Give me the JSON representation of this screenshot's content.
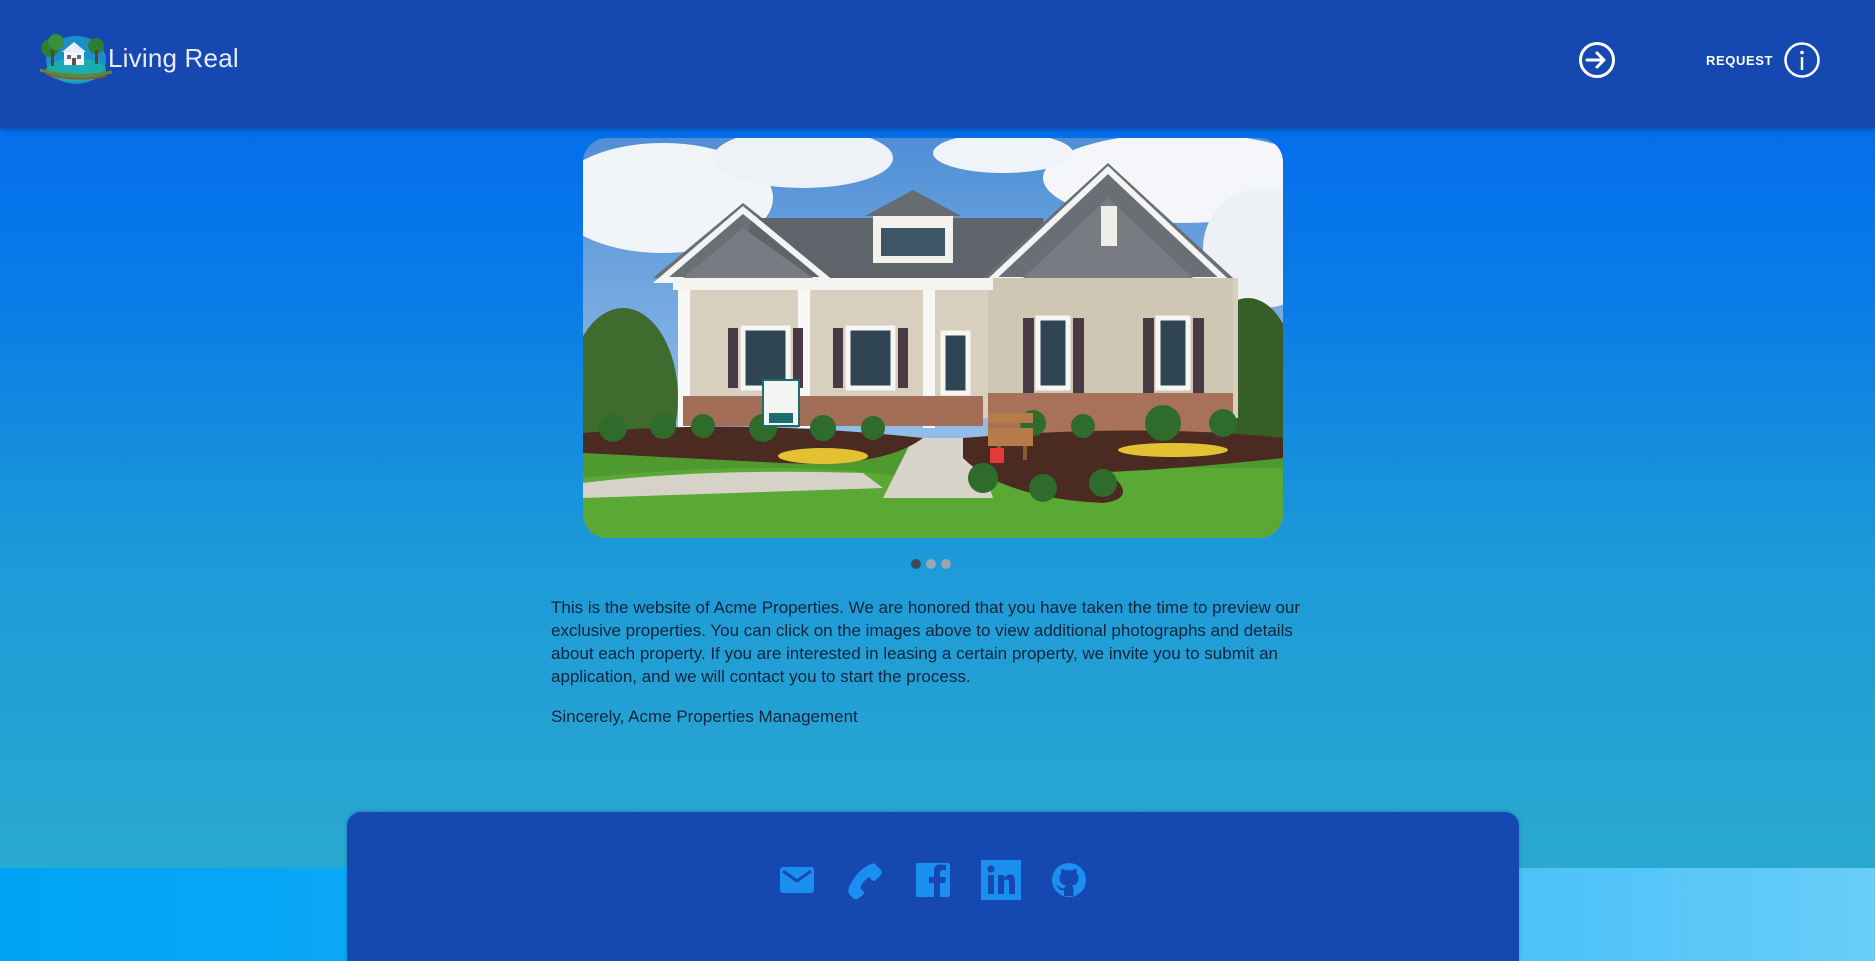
{
  "header": {
    "brand_name": "Living Real",
    "request_label": "REQUEST",
    "login_icon": "login-arrow-icon",
    "info_icon": "info-icon"
  },
  "carousel": {
    "slide_count": 3,
    "active_index": 0
  },
  "intro": {
    "paragraph": "This is the website of Acme Properties. We are honored that you have taken the time to preview our exclusive properties. You can click on the images above to view additional photographs and details about each property. If you are interested in leasing a certain property, we invite you to submit an application, and we will contact you to start the process.",
    "signature": "Sincerely, Acme Properties Management"
  },
  "footer": {
    "icons": [
      "email-icon",
      "phone-icon",
      "facebook-icon",
      "linkedin-icon",
      "github-icon"
    ]
  },
  "colors": {
    "header_bg": "#1648b1",
    "footer_bg": "#1648b1",
    "footer_icon": "#1a8ff0",
    "text": "#13243d"
  }
}
